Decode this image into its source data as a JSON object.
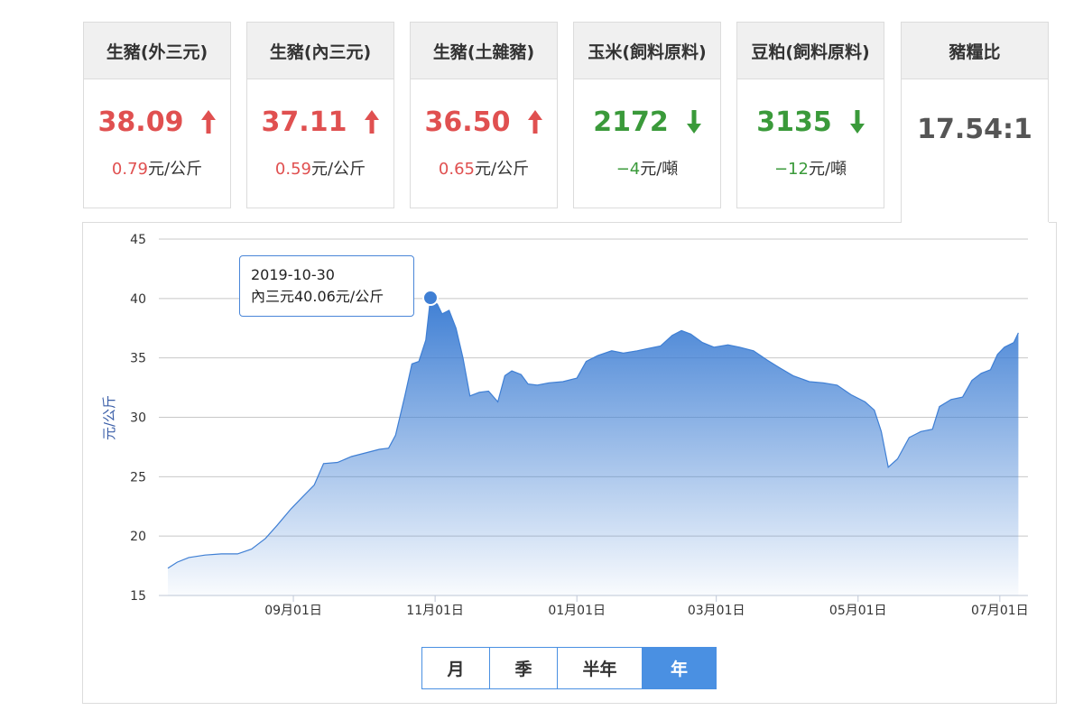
{
  "cards": [
    {
      "title": "生豬(外三元)",
      "price": "38.09",
      "trend": "up",
      "change": "0.79",
      "unit": "元/公斤"
    },
    {
      "title": "生豬(內三元)",
      "price": "37.11",
      "trend": "up",
      "change": "0.59",
      "unit": "元/公斤"
    },
    {
      "title": "生豬(土雜豬)",
      "price": "36.50",
      "trend": "up",
      "change": "0.65",
      "unit": "元/公斤"
    },
    {
      "title": "玉米(飼料原料)",
      "price": "2172",
      "trend": "down",
      "change": "−4",
      "unit": "元/噸"
    },
    {
      "title": "豆粕(飼料原料)",
      "price": "3135",
      "trend": "down",
      "change": "−12",
      "unit": "元/噸"
    }
  ],
  "ratio_card": {
    "title": "豬糧比",
    "value": "17.54:1"
  },
  "colors": {
    "up": "#e05050",
    "down": "#3a9a3a",
    "accent": "#4a90e2",
    "area_top": "#3f7fd4"
  },
  "tooltip": {
    "date": "2019-10-30",
    "text": "內三元40.06元/公斤"
  },
  "range_tabs": [
    {
      "label": "月",
      "active": false
    },
    {
      "label": "季",
      "active": false
    },
    {
      "label": "半年",
      "active": false
    },
    {
      "label": "年",
      "active": true
    }
  ],
  "chart_data": {
    "type": "area",
    "ylabel": "元/公斤",
    "ylim": [
      15,
      45
    ],
    "yticks": [
      15,
      20,
      25,
      30,
      35,
      40,
      45
    ],
    "grid": true,
    "x_range": [
      "2019-07-09",
      "2020-07-10"
    ],
    "x_tick_labels": [
      {
        "label": "09月01日",
        "date": "2019-09-01"
      },
      {
        "label": "11月01日",
        "date": "2019-11-01"
      },
      {
        "label": "01月01日",
        "date": "2020-01-01"
      },
      {
        "label": "03月01日",
        "date": "2020-03-01"
      },
      {
        "label": "05月01日",
        "date": "2020-05-01"
      },
      {
        "label": "07月01日",
        "date": "2020-07-01"
      }
    ],
    "series": [
      {
        "name": "內三元",
        "points": [
          [
            "2019-07-09",
            17.3
          ],
          [
            "2019-07-13",
            17.8
          ],
          [
            "2019-07-18",
            18.2
          ],
          [
            "2019-07-25",
            18.4
          ],
          [
            "2019-08-01",
            18.5
          ],
          [
            "2019-08-08",
            18.5
          ],
          [
            "2019-08-14",
            18.9
          ],
          [
            "2019-08-20",
            19.8
          ],
          [
            "2019-08-25",
            20.9
          ],
          [
            "2019-08-31",
            22.3
          ],
          [
            "2019-09-05",
            23.3
          ],
          [
            "2019-09-10",
            24.3
          ],
          [
            "2019-09-14",
            26.1
          ],
          [
            "2019-09-20",
            26.2
          ],
          [
            "2019-09-26",
            26.7
          ],
          [
            "2019-10-02",
            27.0
          ],
          [
            "2019-10-08",
            27.3
          ],
          [
            "2019-10-12",
            27.4
          ],
          [
            "2019-10-15",
            28.5
          ],
          [
            "2019-10-19",
            31.8
          ],
          [
            "2019-10-22",
            34.5
          ],
          [
            "2019-10-25",
            34.7
          ],
          [
            "2019-10-28",
            36.5
          ],
          [
            "2019-10-30",
            40.06
          ],
          [
            "2019-11-02",
            39.5
          ],
          [
            "2019-11-04",
            38.7
          ],
          [
            "2019-11-07",
            39.0
          ],
          [
            "2019-11-10",
            37.5
          ],
          [
            "2019-11-13",
            35.0
          ],
          [
            "2019-11-16",
            31.8
          ],
          [
            "2019-11-20",
            32.1
          ],
          [
            "2019-11-24",
            32.2
          ],
          [
            "2019-11-28",
            31.3
          ],
          [
            "2019-12-01",
            33.5
          ],
          [
            "2019-12-04",
            33.9
          ],
          [
            "2019-12-08",
            33.6
          ],
          [
            "2019-12-11",
            32.8
          ],
          [
            "2019-12-15",
            32.7
          ],
          [
            "2019-12-20",
            32.9
          ],
          [
            "2019-12-26",
            33.0
          ],
          [
            "2020-01-01",
            33.3
          ],
          [
            "2020-01-05",
            34.7
          ],
          [
            "2020-01-10",
            35.2
          ],
          [
            "2020-01-16",
            35.6
          ],
          [
            "2020-01-21",
            35.4
          ],
          [
            "2020-01-27",
            35.6
          ],
          [
            "2020-02-01",
            35.8
          ],
          [
            "2020-02-06",
            36.0
          ],
          [
            "2020-02-11",
            36.9
          ],
          [
            "2020-02-15",
            37.3
          ],
          [
            "2020-02-19",
            37.0
          ],
          [
            "2020-02-24",
            36.3
          ],
          [
            "2020-02-29",
            35.9
          ],
          [
            "2020-03-06",
            36.1
          ],
          [
            "2020-03-11",
            35.9
          ],
          [
            "2020-03-17",
            35.6
          ],
          [
            "2020-03-23",
            34.8
          ],
          [
            "2020-03-28",
            34.2
          ],
          [
            "2020-04-03",
            33.5
          ],
          [
            "2020-04-10",
            33.0
          ],
          [
            "2020-04-16",
            32.9
          ],
          [
            "2020-04-22",
            32.7
          ],
          [
            "2020-04-28",
            31.9
          ],
          [
            "2020-05-04",
            31.3
          ],
          [
            "2020-05-08",
            30.6
          ],
          [
            "2020-05-11",
            28.8
          ],
          [
            "2020-05-14",
            25.8
          ],
          [
            "2020-05-18",
            26.5
          ],
          [
            "2020-05-23",
            28.3
          ],
          [
            "2020-05-28",
            28.8
          ],
          [
            "2020-06-02",
            29.0
          ],
          [
            "2020-06-05",
            30.9
          ],
          [
            "2020-06-10",
            31.5
          ],
          [
            "2020-06-15",
            31.7
          ],
          [
            "2020-06-19",
            33.1
          ],
          [
            "2020-06-23",
            33.7
          ],
          [
            "2020-06-27",
            34.0
          ],
          [
            "2020-06-30",
            35.3
          ],
          [
            "2020-07-03",
            35.9
          ],
          [
            "2020-07-07",
            36.3
          ],
          [
            "2020-07-09",
            37.11
          ]
        ]
      }
    ],
    "highlight": {
      "x": "2019-10-30",
      "y": 40.06
    }
  }
}
